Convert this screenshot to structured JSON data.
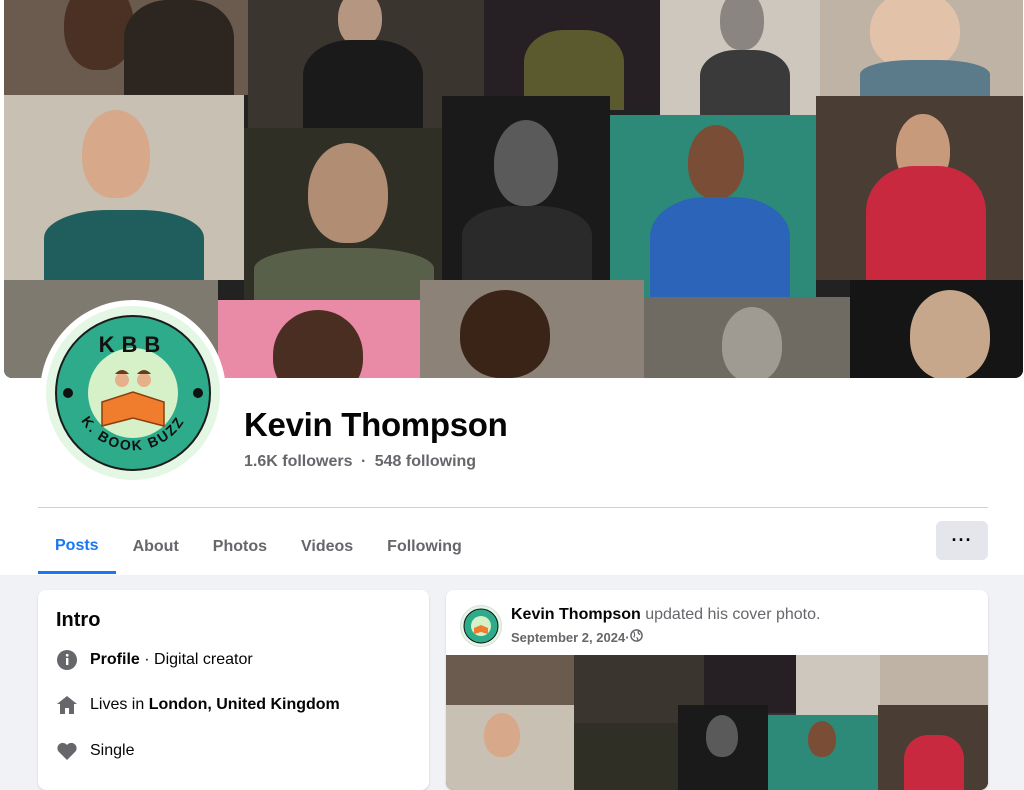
{
  "profile": {
    "name": "Kevin Thompson",
    "followers": "1.6K followers",
    "separator": "·",
    "following": "548 following"
  },
  "logo": {
    "top_text": "KBB",
    "bottom_text": "K. BOOK BUZZ"
  },
  "tabs": [
    {
      "label": "Posts",
      "active": true
    },
    {
      "label": "About"
    },
    {
      "label": "Photos"
    },
    {
      "label": "Videos"
    },
    {
      "label": "Following"
    }
  ],
  "more_label": "···",
  "intro": {
    "title": "Intro",
    "profile_label": "Profile",
    "profile_type": " · Digital creator",
    "lives_prefix": "Lives in ",
    "lives_city": "London, United Kingdom",
    "relationship": "Single"
  },
  "post": {
    "author": "Kevin Thompson",
    "action": " updated his cover photo.",
    "date": "September 2, 2024",
    "date_sep": " · ",
    "privacy_icon": "globe-icon"
  },
  "colors": {
    "accent": "#1877f2",
    "muted": "#65676b",
    "logo_green": "#2eab8a"
  }
}
